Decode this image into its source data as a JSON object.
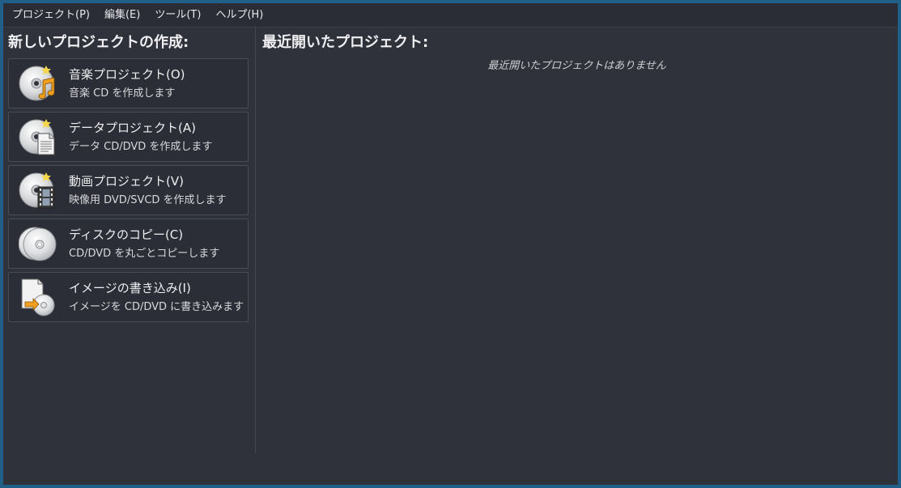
{
  "menubar": {
    "items": [
      "プロジェクト(P)",
      "編集(E)",
      "ツール(T)",
      "ヘルプ(H)"
    ]
  },
  "new_project": {
    "title": "新しいプロジェクトの作成:",
    "buttons": [
      {
        "icon": "audio-cd-icon",
        "title": "音楽プロジェクト(O)",
        "desc": "音楽 CD を作成します"
      },
      {
        "icon": "data-cd-icon",
        "title": "データプロジェクト(A)",
        "desc": "データ CD/DVD を作成します"
      },
      {
        "icon": "video-cd-icon",
        "title": "動画プロジェクト(V)",
        "desc": "映像用 DVD/SVCD を作成します"
      },
      {
        "icon": "copy-disc-icon",
        "title": "ディスクのコピー(C)",
        "desc": "CD/DVD を丸ごとコピーします"
      },
      {
        "icon": "burn-image-icon",
        "title": "イメージの書き込み(I)",
        "desc": "イメージを CD/DVD に書き込みます"
      }
    ]
  },
  "recent": {
    "title": "最近開いたプロジェクト:",
    "empty_message": "最近開いたプロジェクトはありません"
  },
  "colors": {
    "desktop": "#1f5f88",
    "window_bg": "#2f323b",
    "accent_star": "#f3d64a",
    "accent_note": "#f0a020"
  }
}
